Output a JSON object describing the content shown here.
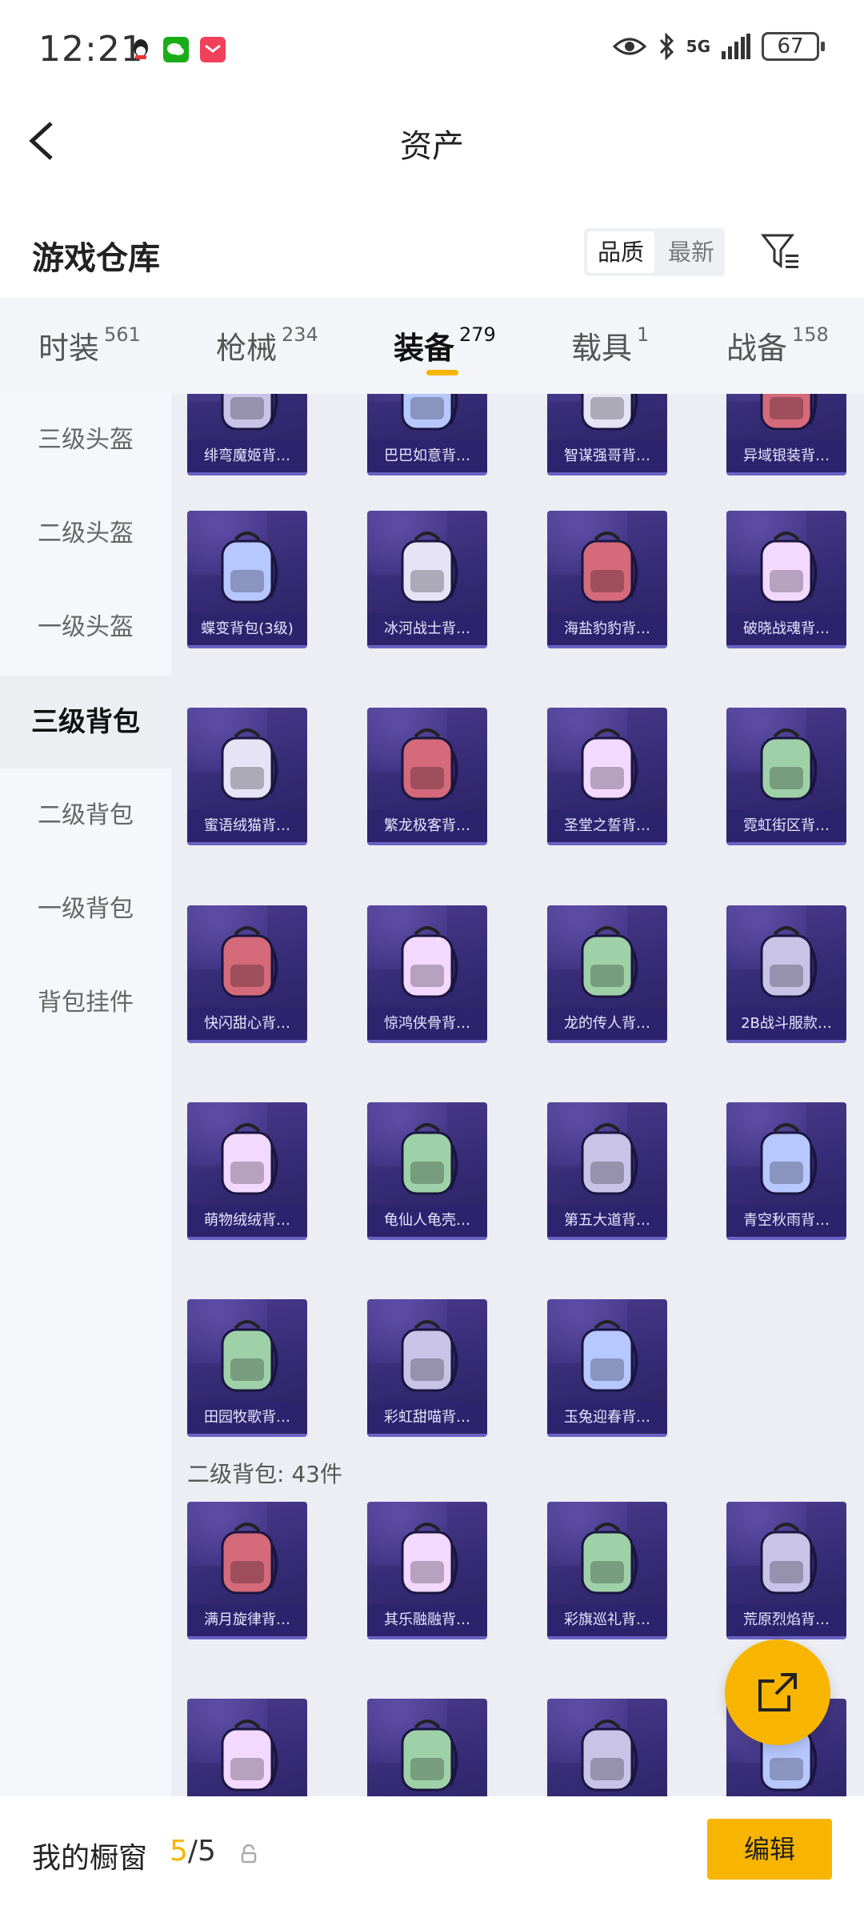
{
  "status_bar": {
    "time": "12:21",
    "network": "5G",
    "battery": "67"
  },
  "header": {
    "title": "资产",
    "back_icon": "chevron-left-icon"
  },
  "warehouse": {
    "title": "游戏仓库",
    "sort_options": [
      "品质",
      "最新"
    ],
    "sort_selected": "品质",
    "filter_icon": "filter-list-icon"
  },
  "tabs": [
    {
      "label": "时装",
      "count": "561"
    },
    {
      "label": "枪械",
      "count": "234"
    },
    {
      "label": "装备",
      "count": "279"
    },
    {
      "label": "载具",
      "count": "1"
    },
    {
      "label": "战备",
      "count": "158"
    }
  ],
  "active_tab": "装备",
  "sidebar": {
    "items": [
      "三级头盔",
      "二级头盔",
      "一级头盔",
      "三级背包",
      "二级背包",
      "一级背包",
      "背包挂件"
    ],
    "active": "三级背包"
  },
  "grid": {
    "rows": [
      [
        "绯弯魔姬背…",
        "巴巴如意背…",
        "智谋强哥背…",
        "异域银装背…"
      ],
      [
        "蝶变背包(3级)",
        "冰河战士背…",
        "海盐豹豹背…",
        "破晓战魂背…"
      ],
      [
        "蜜语绒猫背…",
        "繁龙极客背…",
        "圣堂之誓背…",
        "霓虹街区背…"
      ],
      [
        "快闪甜心背…",
        "惊鸿侠骨背…",
        "龙的传人背…",
        "2B战斗服款…"
      ],
      [
        "萌物绒绒背…",
        "龟仙人龟壳…",
        "第五大道背…",
        "青空秋雨背…"
      ],
      [
        "田园牧歌背…",
        "彩虹甜喵背…",
        "玉兔迎春背…"
      ]
    ],
    "group_label": "二级背包: 43件",
    "group_rows": [
      [
        "满月旋律背…",
        "其乐融融背…",
        "彩旗巡礼背…",
        "荒原烈焰背…"
      ],
      [
        "",
        "",
        "",
        ""
      ]
    ]
  },
  "fab": {
    "icon": "share-icon"
  },
  "bottom_bar": {
    "showcase_label": "我的橱窗",
    "used": "5",
    "total": "/5",
    "lock_icon": "lock-icon",
    "edit_label": "编辑"
  },
  "colors": {
    "accent": "#f7b500",
    "card_bg": "#3a2e7e",
    "card_border": "#6b62c4"
  }
}
